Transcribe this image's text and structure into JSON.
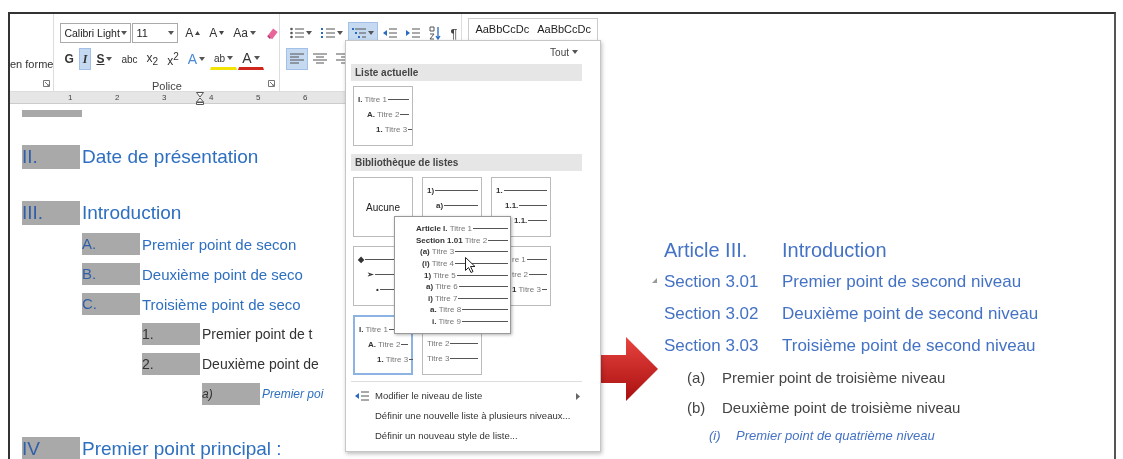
{
  "ribbon": {
    "left_group_label": "en forme",
    "font_name": "Calibri Light",
    "font_size": "11",
    "font_row1": [
      {
        "kind": "grow",
        "label": "A"
      },
      {
        "kind": "shrink",
        "label": "A"
      },
      {
        "kind": "case",
        "label": "Aa"
      },
      {
        "kind": "clear"
      }
    ],
    "font_row2": [
      {
        "kind": "bold",
        "label": "G",
        "selected": false
      },
      {
        "kind": "italic",
        "label": "I",
        "selected": true
      },
      {
        "kind": "underline",
        "label": "S",
        "selected": false
      },
      {
        "kind": "strike",
        "label": "abc",
        "selected": false
      },
      {
        "kind": "subscript",
        "label": "x$_{2}$",
        "selected": false
      },
      {
        "kind": "superscript",
        "label": "x$^{2}$",
        "selected": false
      },
      {
        "kind": "effects",
        "label": "A"
      },
      {
        "kind": "highlight",
        "label": "ab"
      },
      {
        "kind": "color",
        "label": "A"
      }
    ],
    "font_group_label": "Police",
    "paragraph_row1": [
      {
        "kind": "bullets",
        "selected": false
      },
      {
        "kind": "numbering",
        "selected": false
      },
      {
        "kind": "multilevel",
        "selected": true
      },
      {
        "kind": "outdent",
        "selected": false
      },
      {
        "kind": "indent",
        "selected": false
      },
      {
        "kind": "sort",
        "selected": false
      },
      {
        "kind": "marks",
        "label": "¶",
        "selected": false
      }
    ],
    "paragraph_row2": [
      {
        "kind": "left",
        "selected": true
      },
      {
        "kind": "center",
        "selected": false
      },
      {
        "kind": "right",
        "selected": false
      }
    ],
    "style_previews": [
      "AaBbCcDc",
      "AaBbCcDc"
    ]
  },
  "ruler": [
    "1",
    "2",
    "3",
    "4",
    "5",
    "6"
  ],
  "document": {
    "headings": [
      {
        "number": "II.",
        "text": "Date de présentation"
      },
      {
        "number": "III.",
        "text": "Introduction",
        "children": [
          {
            "number": "A.",
            "text": "Premier point de secon"
          },
          {
            "number": "B.",
            "text": "Deuxième point de seco"
          },
          {
            "number": "C.",
            "text": "Troisième point de seco",
            "children": [
              {
                "number": "1.",
                "text": "Premier point de t"
              },
              {
                "number": "2.",
                "text": "Deuxième point de",
                "children": [
                  {
                    "number": "a)",
                    "text": "Premier poi"
                  }
                ]
              }
            ]
          }
        ]
      },
      {
        "number": "IV",
        "text": "Premier point principal :"
      }
    ]
  },
  "list_menu": {
    "filter": "Tout",
    "current_header": "Liste actuelle",
    "current": [
      {
        "kind": "list",
        "selected": false,
        "lines": [
          {
            "marker": "I.",
            "label": "Titre 1"
          },
          {
            "marker": "A.",
            "label": "Titre 2"
          },
          {
            "marker": "1.",
            "label": "Titre 3"
          }
        ]
      }
    ],
    "library_header": "Bibliothèque de listes",
    "library": [
      [
        {
          "kind": "none",
          "label": "Aucune",
          "selected": false
        },
        {
          "kind": "list",
          "selected": false,
          "lines": [
            {
              "marker": "1)"
            },
            {
              "marker": "a)"
            }
          ]
        },
        {
          "kind": "list",
          "selected": false,
          "lines": [
            {
              "marker": "1."
            },
            {
              "marker": "1.1."
            },
            {
              "marker": "1.1."
            }
          ]
        }
      ],
      [
        {
          "kind": "list",
          "selected": false,
          "lines": [
            {
              "marker": "◆"
            },
            {
              "marker": "➢"
            },
            {
              "marker": "•"
            }
          ]
        },
        {
          "kind": "clipped-left",
          "selected": false,
          "lines": [
            {
              "label": "re 1"
            },
            {
              "label": "tre 2"
            },
            {
              "marker": "1",
              "label": "Titre 3"
            }
          ]
        }
      ],
      [
        {
          "kind": "list",
          "selected": true,
          "lines": [
            {
              "marker": "I.",
              "label": "Titre 1"
            },
            {
              "marker": "A.",
              "label": "Titre 2"
            },
            {
              "marker": "1.",
              "label": "Titre 3"
            }
          ]
        },
        {
          "kind": "clipped-top",
          "selected": false,
          "lines": [
            {
              "label": "Titre 2"
            },
            {
              "label": "Titre 3"
            }
          ]
        }
      ]
    ],
    "preview": [
      {
        "marker": "Article I.",
        "label": "Titre 1"
      },
      {
        "marker": "Section 1.01",
        "label": "Titre 2"
      },
      {
        "marker": "(a)",
        "label": "Titre 3"
      },
      {
        "marker": "(i)",
        "label": "Titre 4"
      },
      {
        "marker": "1)",
        "label": "Titre 5"
      },
      {
        "marker": "a)",
        "label": "Titre 6"
      },
      {
        "marker": "i)",
        "label": "Titre 7"
      },
      {
        "marker": "a.",
        "label": "Titre 8"
      },
      {
        "marker": "i.",
        "label": "Titre 9"
      }
    ],
    "commands": [
      {
        "kind": "level",
        "label": "Modifier le niveau de liste",
        "submenu": true
      },
      {
        "kind": "plain",
        "label": "Définir une nouvelle liste à plusieurs niveaux...",
        "submenu": false
      },
      {
        "kind": "plain",
        "label": "Définir un nouveau style de liste...",
        "submenu": false
      }
    ]
  },
  "result": {
    "headings": [
      {
        "number": "Article III.",
        "text": "Introduction",
        "children": [
          {
            "number": "Section 3.01",
            "text": "Premier point de second niveau",
            "expand_marker": true
          },
          {
            "number": "Section 3.02",
            "text": "Deuxième point de second niveau"
          },
          {
            "number": "Section 3.03",
            "text": "Troisième point de second niveau",
            "children": [
              {
                "number": "(a)",
                "text": "Premier point de troisième niveau"
              },
              {
                "number": "(b)",
                "text": "Deuxième point de troisième niveau",
                "children": [
                  {
                    "number": "(i)",
                    "text": "Premier point de quatrième niveau"
                  }
                ]
              }
            ]
          }
        ]
      }
    ]
  }
}
